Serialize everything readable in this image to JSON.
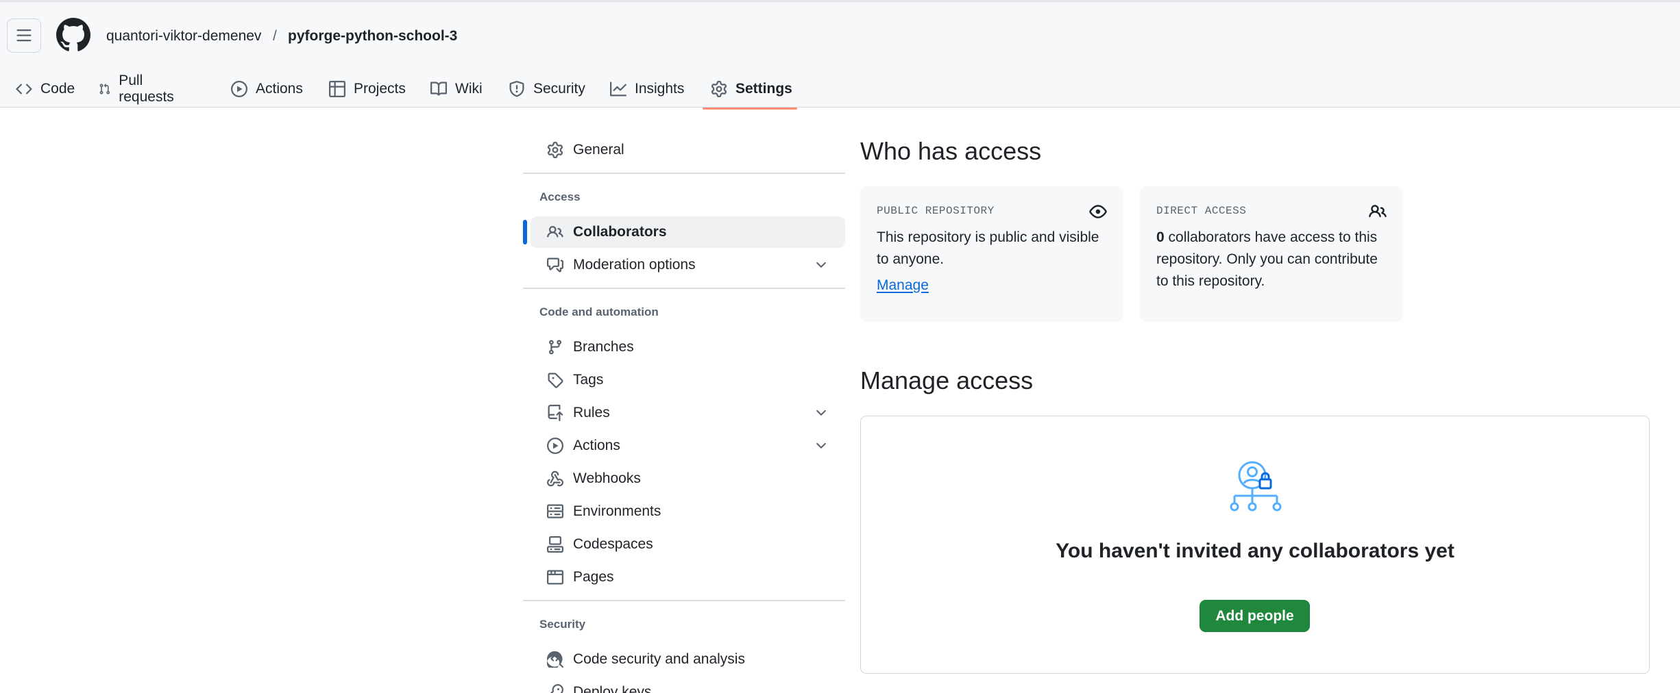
{
  "header": {
    "owner": "quantori-viktor-demenev",
    "separator": "/",
    "repo": "pyforge-python-school-3"
  },
  "tabs": [
    {
      "label": "Code",
      "icon": "code-icon"
    },
    {
      "label": "Pull requests",
      "icon": "git-pull-request-icon"
    },
    {
      "label": "Actions",
      "icon": "play-icon"
    },
    {
      "label": "Projects",
      "icon": "table-icon"
    },
    {
      "label": "Wiki",
      "icon": "book-icon"
    },
    {
      "label": "Security",
      "icon": "shield-icon"
    },
    {
      "label": "Insights",
      "icon": "graph-icon"
    },
    {
      "label": "Settings",
      "icon": "gear-icon",
      "selected": true
    }
  ],
  "sidebar": {
    "general": "General",
    "access_heading": "Access",
    "collaborators": "Collaborators",
    "moderation": "Moderation options",
    "code_heading": "Code and automation",
    "branches": "Branches",
    "tags": "Tags",
    "rules": "Rules",
    "actions": "Actions",
    "webhooks": "Webhooks",
    "environments": "Environments",
    "codespaces": "Codespaces",
    "pages": "Pages",
    "security_heading": "Security",
    "code_security": "Code security and analysis",
    "deploy_keys": "Deploy keys"
  },
  "main": {
    "who_title": "Who has access",
    "public_card": {
      "label": "PUBLIC REPOSITORY",
      "text": "This repository is public and visible to anyone.",
      "link": "Manage"
    },
    "direct_card": {
      "label": "DIRECT ACCESS",
      "count": "0",
      "text": " collaborators have access to this repository. Only you can contribute to this repository."
    },
    "manage_title": "Manage access",
    "empty_title": "You haven't invited any collaborators yet",
    "add_button": "Add people"
  },
  "colors": {
    "accent": "#0969da",
    "tab_underline": "#fd8c73",
    "primary_button": "#1f883d"
  }
}
